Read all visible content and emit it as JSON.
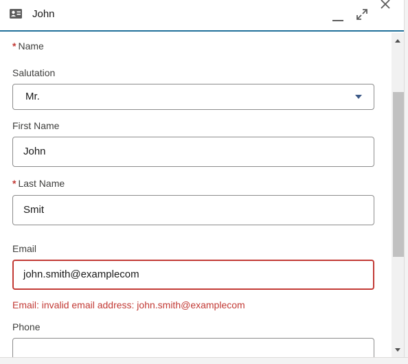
{
  "header": {
    "title": "John",
    "icons": {
      "contact": "contact-card-icon",
      "minimize": "minimize-icon",
      "expand": "expand-icon",
      "close": "close-icon"
    }
  },
  "form": {
    "name_section": {
      "required_marker": "*",
      "label": "Name"
    },
    "salutation": {
      "label": "Salutation",
      "value": "Mr."
    },
    "first_name": {
      "label": "First Name",
      "value": "John"
    },
    "last_name": {
      "required_marker": "*",
      "label": "Last Name",
      "value": "Smit"
    },
    "email": {
      "label": "Email",
      "value": "john.smith@examplecom",
      "error": "Email: invalid email address: john.smith@examplecom"
    },
    "phone": {
      "label": "Phone",
      "value": ""
    }
  },
  "colors": {
    "accent": "#1f6f9a",
    "error": "#c23934",
    "required": "#c23934"
  }
}
